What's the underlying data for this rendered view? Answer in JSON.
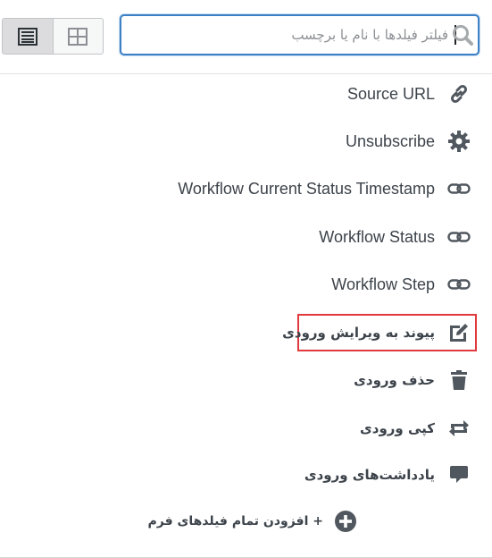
{
  "toolbar": {
    "view_list_icon": "list-view-icon",
    "view_grid_icon": "grid-view-icon",
    "search": {
      "placeholder": "فیلتر فیلدها با نام یا برچسب",
      "value": "",
      "icon": "search-icon"
    }
  },
  "fields": [
    {
      "label": "Source URL",
      "icon": "link-icon",
      "rtl": false
    },
    {
      "label": "Unsubscribe",
      "icon": "gear-icon",
      "rtl": false
    },
    {
      "label": "Workflow Current Status Timestamp",
      "icon": "chain-icon",
      "rtl": false
    },
    {
      "label": "Workflow Status",
      "icon": "chain-icon",
      "rtl": false
    },
    {
      "label": "Workflow Step",
      "icon": "chain-icon",
      "rtl": false
    },
    {
      "label": "پیوند به ویرایش ورودی",
      "icon": "edit-icon",
      "rtl": true,
      "highlighted": true
    },
    {
      "label": "حذف ورودی",
      "icon": "trash-icon",
      "rtl": true
    },
    {
      "label": "کپی ورودی",
      "icon": "repeat-icon",
      "rtl": true
    },
    {
      "label": "یادداشت‌های ورودی",
      "icon": "comment-icon",
      "rtl": true
    }
  ],
  "add_all": {
    "label": "+ افزودن تمام فیلدهای فرم",
    "icon": "plus-circle-icon"
  },
  "colors": {
    "accent": "#3c80c6",
    "highlight": "#e0393e",
    "icon": "#50575e"
  }
}
